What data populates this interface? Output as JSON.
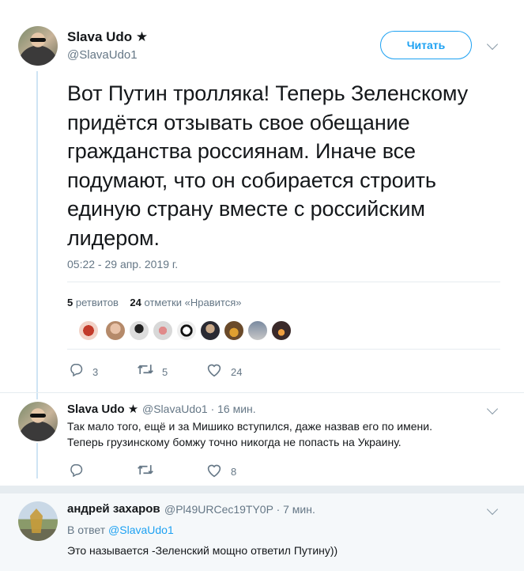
{
  "main_tweet": {
    "author_name": "Slava Udo ★",
    "author_handle": "@SlavaUdo1",
    "follow_label": "Читать",
    "text": "Вот Путин тролляка! Теперь Зеленскому придётся отзывать свое обещание гражданства россиянам. Иначе все подумают, что он собирается строить единую страну вместе с российским лидером.",
    "timestamp": "05:22 - 29 апр. 2019 г.",
    "retweets_count": "5",
    "retweets_label": "ретвитов",
    "likes_count": "24",
    "likes_label": "отметки «Нравится»",
    "actions": {
      "replies": "3",
      "retweets": "5",
      "likes": "24"
    }
  },
  "reply_1": {
    "author_name": "Slava Udo ★",
    "meta": "@SlavaUdo1 · 16 мин.",
    "text_line1": "Так мало того, ещё и за Мишико вступился, даже назвав его по имени.",
    "text_line2": "Теперь грузинскому бомжу точно никогда не попасть на Украину.",
    "actions": {
      "replies": "",
      "retweets": "",
      "likes": "8"
    }
  },
  "reply_2": {
    "author_name": "андрей захаров",
    "meta": "@Pl49URCec19TY0P · 7 мин.",
    "reply_to_label": "В ответ",
    "reply_to_handle": "@SlavaUdo1",
    "text": "Это называется -Зеленский мощно ответил Путину))"
  },
  "colors": {
    "accent": "#1da1f2",
    "secondary_text": "#657786",
    "border": "#e6ecf0"
  },
  "icons": [
    "reply-icon",
    "retweet-icon",
    "like-icon",
    "chevron-down-icon"
  ]
}
